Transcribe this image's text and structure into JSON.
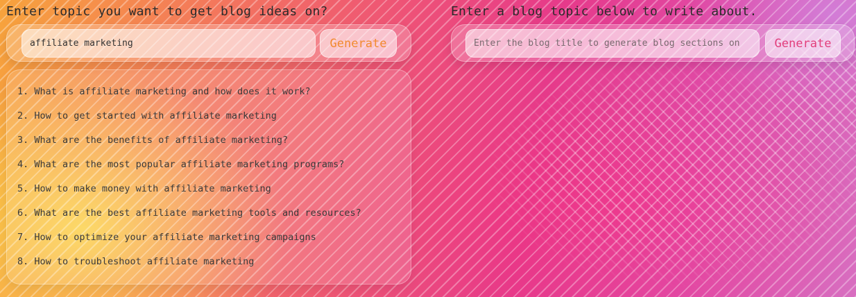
{
  "left_panel": {
    "heading": "Enter topic you want to get blog ideas on?",
    "topic_input_value": "affiliate marketing",
    "generate_label": "Generate",
    "ideas": [
      "1. What is affiliate marketing and how does it work?",
      "2. How to get started with affiliate marketing",
      "3. What are the benefits of affiliate marketing?",
      "4. What are the most popular affiliate marketing programs?",
      "5. How to make money with affiliate marketing",
      "6. What are the best affiliate marketing tools and resources?",
      "7. How to optimize your affiliate marketing campaigns",
      "8. How to troubleshoot affiliate marketing"
    ]
  },
  "right_panel": {
    "heading": "Enter a blog topic below to write about.",
    "title_input_placeholder": "Enter the blog title to generate blog sections on",
    "generate_label": "Generate"
  },
  "colors": {
    "left_generate_text": "#f28a2e",
    "right_generate_text": "#e23e7c"
  }
}
